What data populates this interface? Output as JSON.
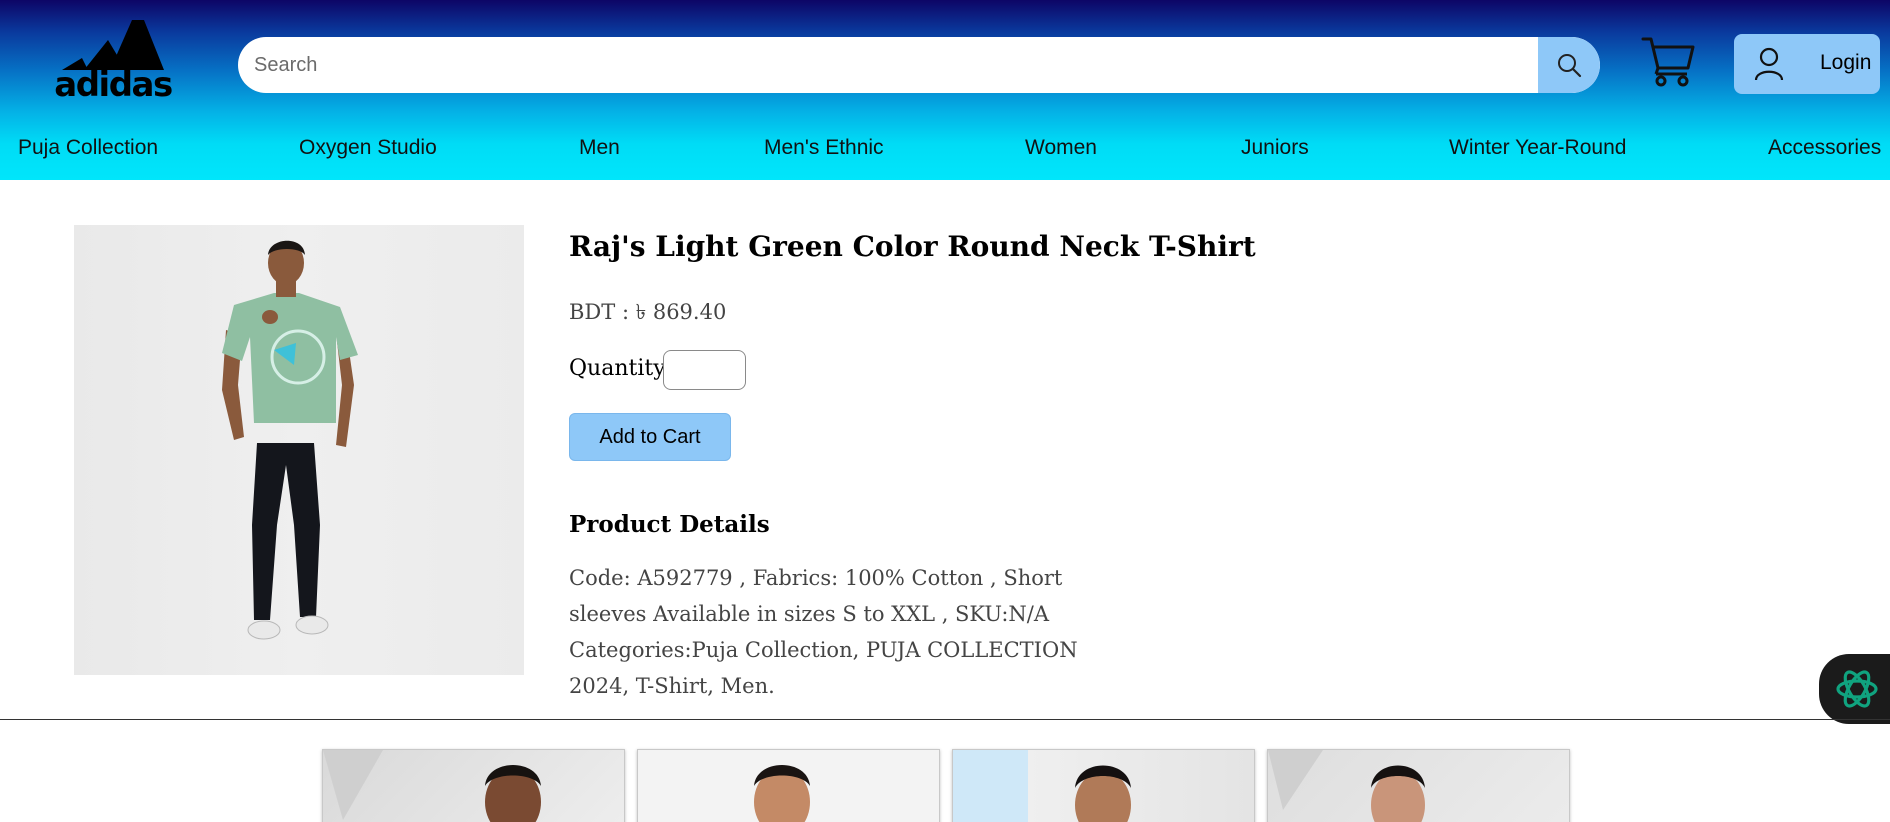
{
  "header": {
    "logo_text": "adidas",
    "search": {
      "placeholder": "Search",
      "value": ""
    },
    "search_icon": "search-icon",
    "cart_icon": "cart-icon",
    "login": {
      "label": "Login",
      "icon": "user-icon"
    },
    "colors": {
      "gradient_top": "#0d0566",
      "gradient_bottom": "#00e6fb",
      "button_bg": "#8ec8f8"
    }
  },
  "nav": {
    "items": [
      "Puja Collection",
      "Oxygen Studio",
      "Men",
      "Men's Ethnic",
      "Women",
      "Juniors",
      "Winter Year-Round",
      "Accessories"
    ]
  },
  "product": {
    "title": "Raj's Light Green Color Round Neck T-Shirt",
    "price_label": "BDT : ৳ 869.40",
    "quantity_label": "Quantity",
    "quantity_value": "",
    "add_to_cart_label": "Add to Cart",
    "details_heading": "Product Details",
    "details_text": "Code: A592779 , Fabrics: 100% Cotton , Short sleeves Available in sizes S to XXL , SKU:N/A Categories:Puja Collection, PUJA COLLECTION 2024, T-Shirt, Men."
  },
  "chat_widget": {
    "icon": "openai-chat-icon",
    "color": "#10a37f"
  },
  "related_products": [
    {
      "name": "related-product-1"
    },
    {
      "name": "related-product-2"
    },
    {
      "name": "related-product-3"
    },
    {
      "name": "related-product-4"
    }
  ]
}
